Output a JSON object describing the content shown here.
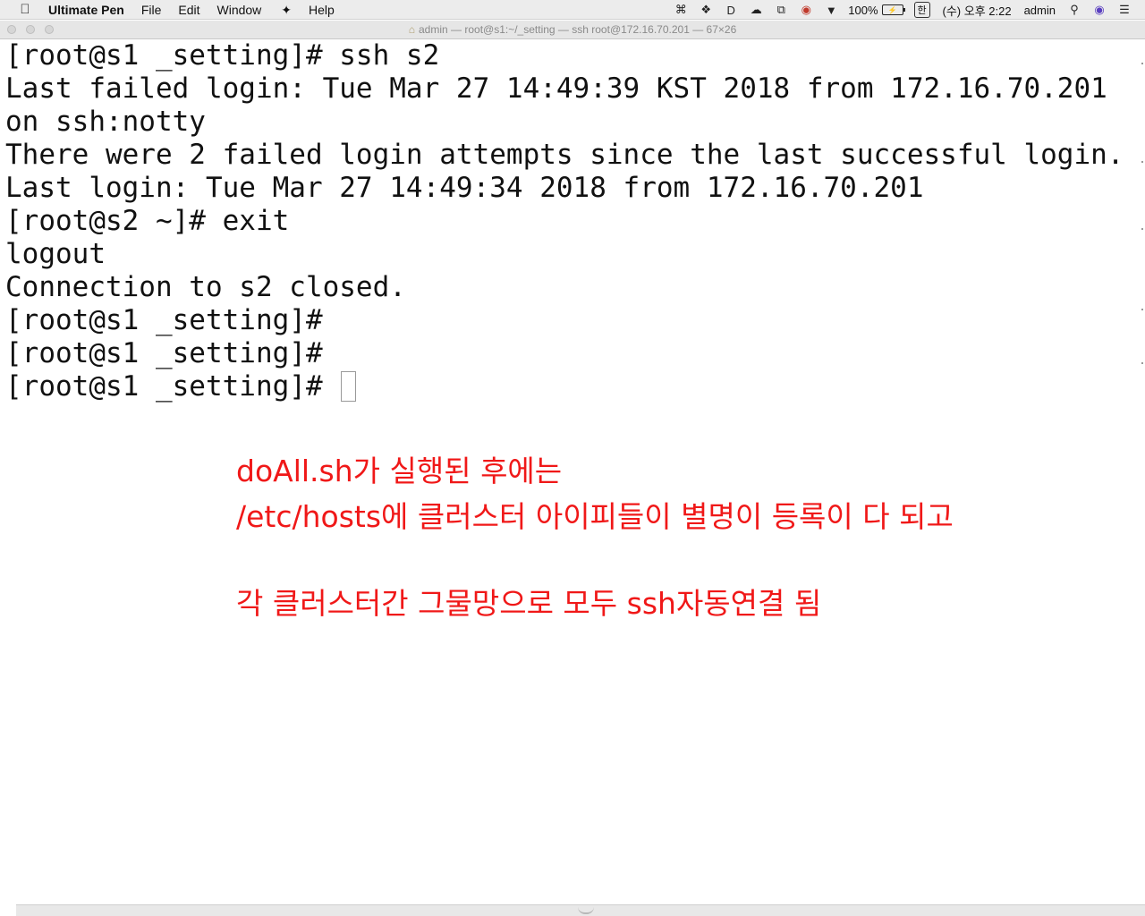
{
  "menubar": {
    "apple_icon": "apple-logo-icon",
    "app_name": "Ultimate Pen",
    "items": [
      "File",
      "Edit",
      "Window",
      "Help"
    ],
    "script_icon": "script-menu-icon",
    "status": {
      "battery_percent": "100%",
      "input_method": "한",
      "clock": "(수) 오후 2:22",
      "user": "admin"
    }
  },
  "window": {
    "title": "admin — root@s1:~/_setting — ssh root@172.16.70.201 — 67×26"
  },
  "terminal": {
    "lines": [
      "[root@s1 _setting]# ssh s2",
      "Last failed login: Tue Mar 27 14:49:39 KST 2018 from 172.16.70.201",
      "on ssh:notty",
      "There were 2 failed login attempts since the last successful login.",
      "Last login: Tue Mar 27 14:49:34 2018 from 172.16.70.201",
      "[root@s2 ~]# exit",
      "logout",
      "Connection to s2 closed.",
      "[root@s1 _setting]#",
      "[root@s1 _setting]#",
      "[root@s1 _setting]# "
    ]
  },
  "annotation": {
    "color": "#f01818",
    "lines": [
      "doAll.sh가 실행된 후에는",
      "/etc/hosts에 클러스터 아이피들이 별명이 등록이 다 되고",
      "각 클러스터간 그물망으로 모두 ssh자동연결 됨"
    ]
  }
}
